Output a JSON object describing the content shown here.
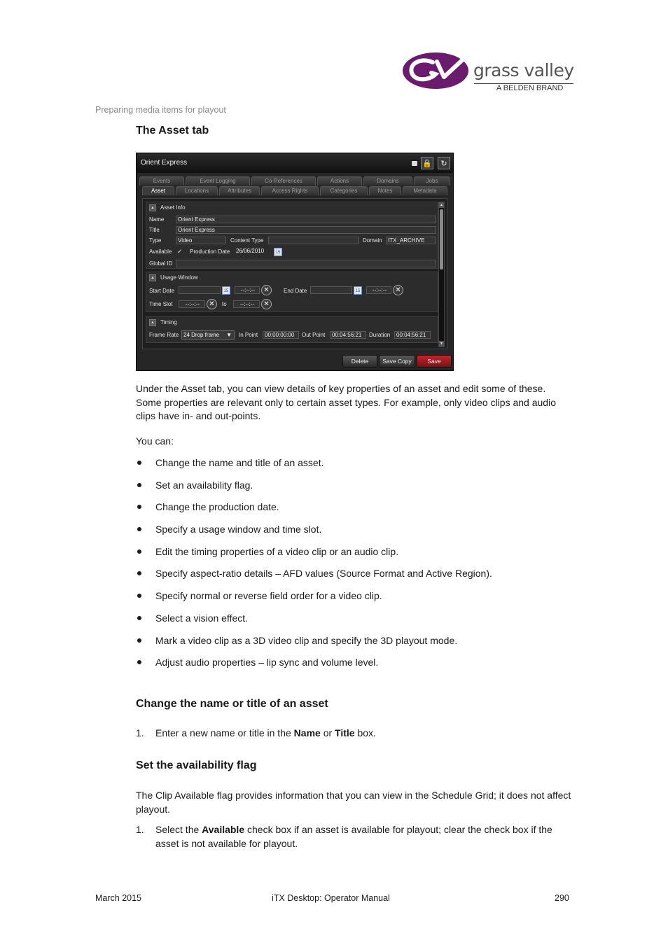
{
  "logo": {
    "word": "grass valley",
    "brand": "A BELDEN BRAND",
    "accent": "#6a1b6e"
  },
  "running_header": "Preparing media items for playout",
  "headings": {
    "asset_tab": "The Asset tab",
    "change_name": "Change the name or title of an asset",
    "availability": "Set the availability flag"
  },
  "window": {
    "title": "Orient Express",
    "tabs_row1": [
      "Events",
      "Event Logging",
      "Co-References",
      "Actions",
      "Domains",
      "Jobs"
    ],
    "tabs_row2": [
      "Asset",
      "Locations",
      "Attributes",
      "Access Rights",
      "Categories",
      "Notes",
      "Metadata"
    ],
    "active_tab": "Asset",
    "asset_info": {
      "header": "Asset Info",
      "name_label": "Name",
      "name_value": "Orient Express",
      "title_label": "Title",
      "title_value": "Orient Express",
      "type_label": "Type",
      "type_value": "Video",
      "content_type_label": "Content Type",
      "content_type_value": "",
      "domain_label": "Domain",
      "domain_value": "ITX_ARCHIVE",
      "available_label": "Available",
      "available_check": "✓",
      "production_date_label": "Production Date",
      "production_date_value": "26/06/2010",
      "global_id_label": "Global ID",
      "global_id_value": ""
    },
    "usage_window": {
      "header": "Usage Window",
      "start_date_label": "Start Date",
      "end_date_label": "End Date",
      "time_slot_label": "Time Slot",
      "to_label": "to",
      "time_placeholder": "--:--:--",
      "calendar_day": "15",
      "clear_glyph": "✕"
    },
    "timing": {
      "header": "Timing",
      "frame_rate_label": "Frame Rate",
      "frame_rate_value": "24 Drop frame",
      "in_point_label": "In Point",
      "in_point_value": "00:00:00:00",
      "out_point_label": "Out Point",
      "out_point_value": "00:04:56:21",
      "duration_label": "Duration",
      "duration_value": "00:04:56:21"
    },
    "buttons": {
      "delete": "Delete",
      "save_copy": "Save Copy",
      "save": "Save"
    }
  },
  "intro_paragraph": "Under the Asset tab, you can view details of key properties of an asset and edit some of these. Some properties are relevant only to certain asset types. For example, only video clips and audio clips have in- and out-points.",
  "you_can": "You can:",
  "bullets": [
    "Change the name and title of an asset.",
    "Set an availability flag.",
    "Change the production date.",
    "Specify a usage window and time slot.",
    "Edit the timing properties of a video clip or an audio clip.",
    "Specify aspect-ratio details – AFD values (Source Format and Active Region).",
    "Specify normal or reverse field order for a video clip.",
    "Select a vision effect.",
    "Mark a video clip as a 3D video clip and specify the 3D playout mode.",
    "Adjust audio properties – lip sync and volume level."
  ],
  "change_name_step": {
    "num": "1.",
    "pre": "Enter a new name or title in the ",
    "b1": "Name",
    "mid": " or ",
    "b2": "Title",
    "post": " box."
  },
  "availability_paragraph": "The Clip Available flag provides information that you can view in the Schedule Grid; it does not affect playout.",
  "availability_step": {
    "num": "1.",
    "pre": "Select the ",
    "b1": "Available",
    "post": " check box if an asset is available for playout; clear the check box if the asset is not available for playout."
  },
  "footer": {
    "date": "March 2015",
    "title": "iTX Desktop: Operator Manual",
    "page": "290"
  }
}
